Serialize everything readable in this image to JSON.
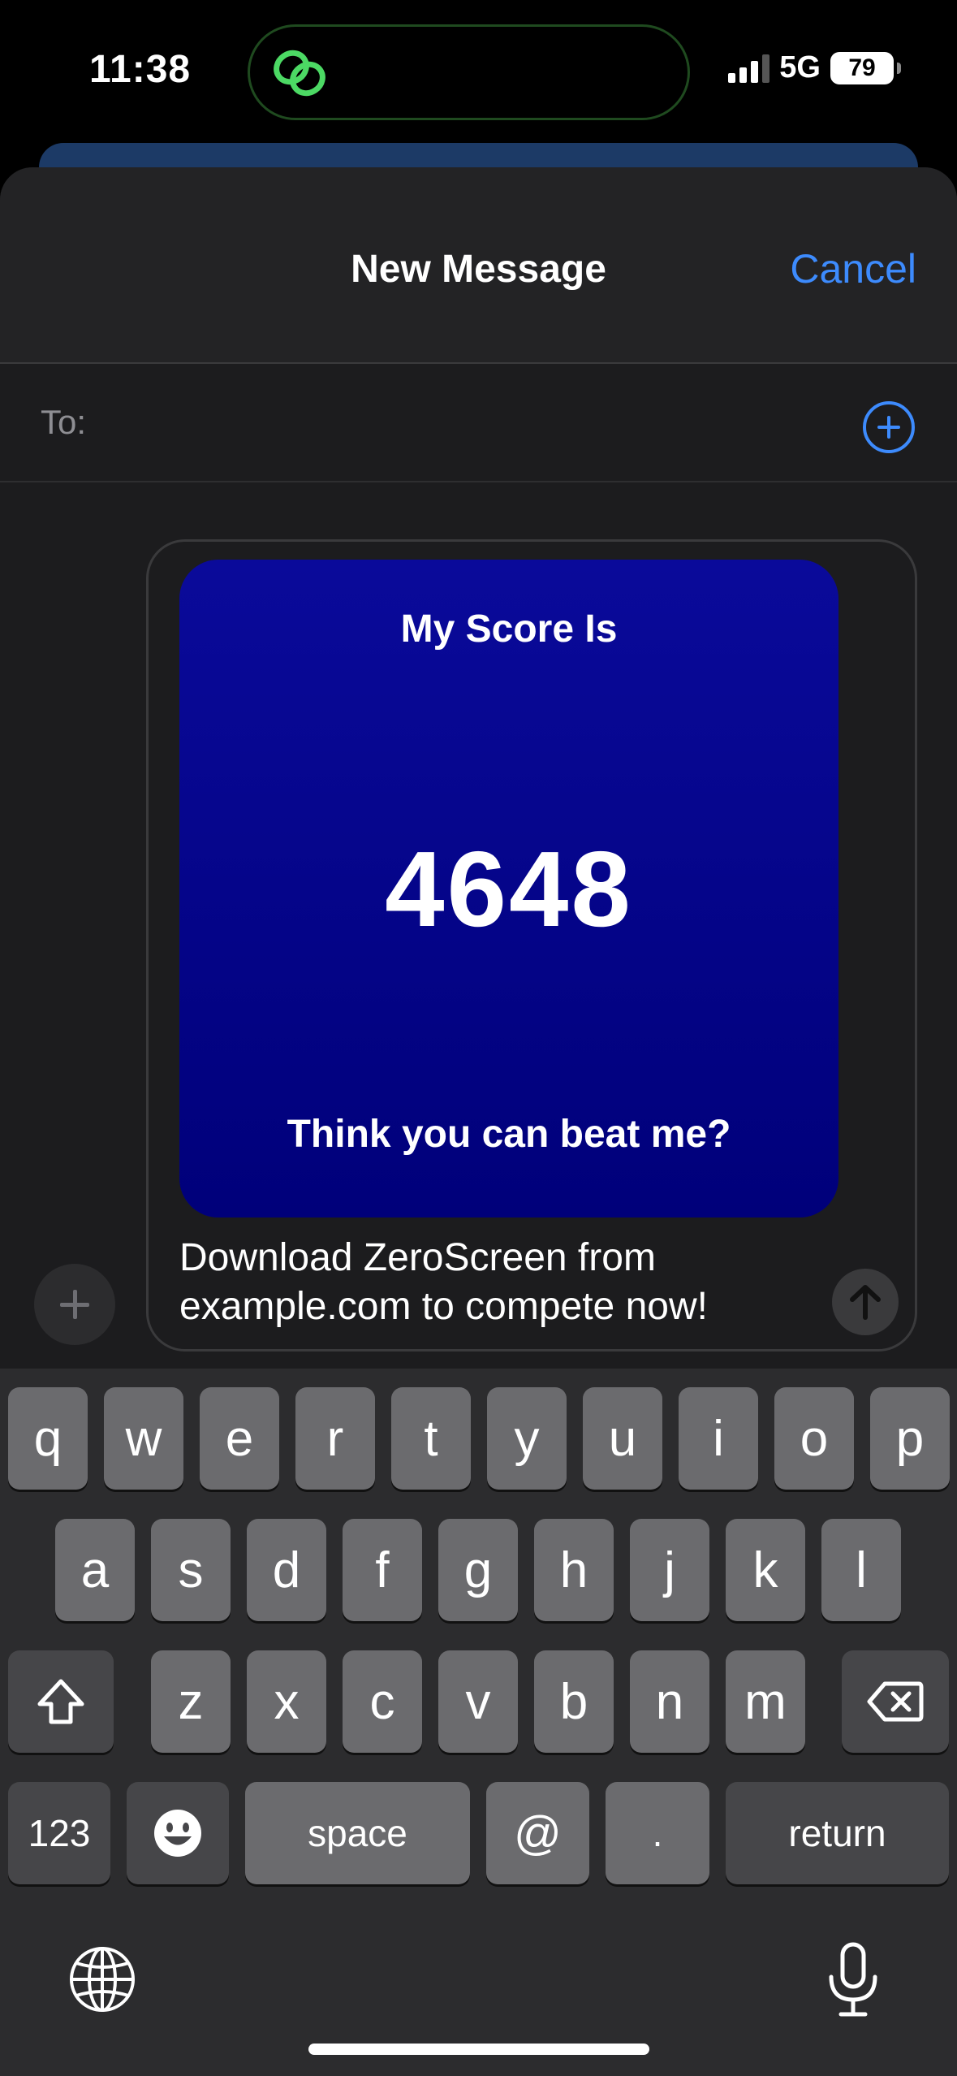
{
  "status_bar": {
    "time": "11:38",
    "network": "5G",
    "battery": "79",
    "signal_bars_active": 3,
    "signal_bars_total": 4
  },
  "sheet": {
    "title": "New Message",
    "cancel_label": "Cancel",
    "to_label": "To:"
  },
  "score_card": {
    "heading": "My Score Is",
    "score": "4648",
    "tagline": "Think you can beat me?"
  },
  "message": {
    "text": "Download ZeroScreen from example.com to compete now!"
  },
  "keyboard": {
    "row1": [
      "q",
      "w",
      "e",
      "r",
      "t",
      "y",
      "u",
      "i",
      "o",
      "p"
    ],
    "row2": [
      "a",
      "s",
      "d",
      "f",
      "g",
      "h",
      "j",
      "k",
      "l"
    ],
    "row3": [
      "z",
      "x",
      "c",
      "v",
      "b",
      "n",
      "m"
    ],
    "numbers_key": "123",
    "space_key": "space",
    "at_key": "@",
    "dot_key": ".",
    "return_key": "return"
  },
  "colors": {
    "accent": "#3d8bfd",
    "score_card_bg": "#00007a",
    "island_icon": "#4cd964"
  },
  "icons": {
    "island": "link-icon",
    "add_contact": "plus-circle-icon",
    "attach": "plus-icon",
    "send": "arrow-up-icon",
    "shift": "shift-icon",
    "delete": "backspace-icon",
    "emoji": "emoji-icon",
    "globe": "globe-icon",
    "dictation": "microphone-icon"
  }
}
